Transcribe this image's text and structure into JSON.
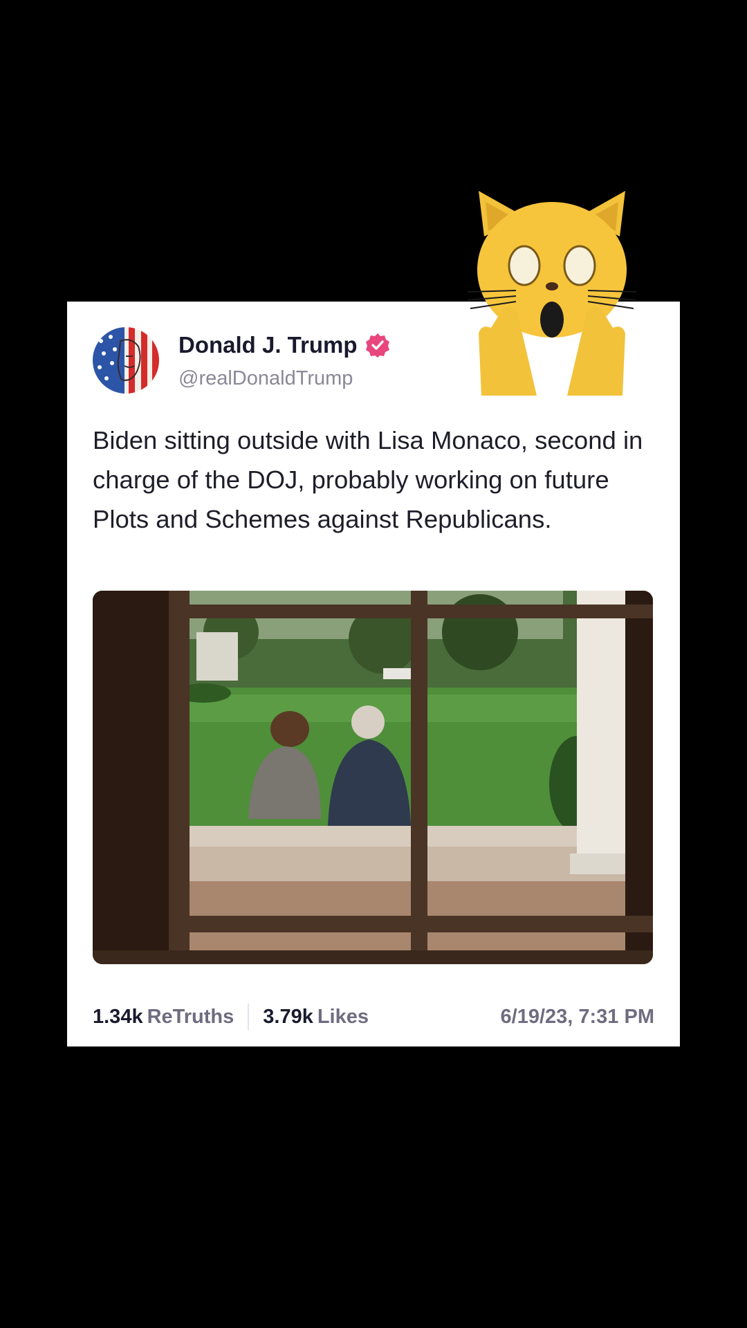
{
  "post": {
    "author": {
      "display_name": "Donald J. Trump",
      "handle": "@realDonaldTrump",
      "verified_icon": "verified-badge-icon"
    },
    "text": "Biden sitting outside with Lisa Monaco, second in charge of the DOJ, probably working on future Plots and Schemes against Republicans.",
    "stats": {
      "retruths_count": "1.34k",
      "retruths_label": "ReTruths",
      "likes_count": "3.79k",
      "likes_label": "Likes",
      "timestamp": "6/19/23, 7:31 PM"
    }
  },
  "overlay": {
    "emoji": "shocked-cat-emoji"
  },
  "colors": {
    "background": "#000000",
    "card": "#ffffff",
    "verified": "#e8467c",
    "name": "#1a1a2e",
    "muted": "#6f6c80"
  }
}
